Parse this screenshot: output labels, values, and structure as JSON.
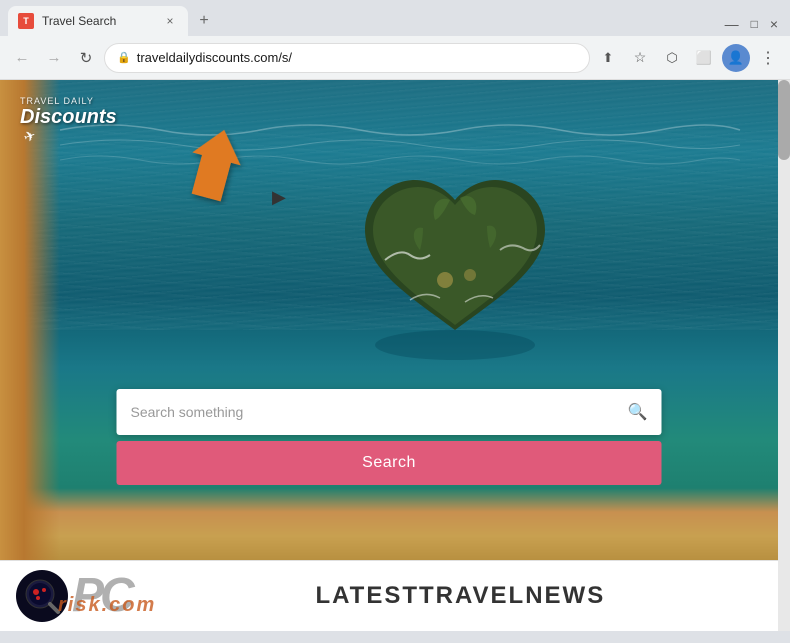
{
  "browser": {
    "tab": {
      "favicon_label": "T",
      "title": "Travel Search",
      "close_label": "×"
    },
    "new_tab_label": "+",
    "window_controls": {
      "minimize": "—",
      "maximize": "□",
      "close": "×"
    },
    "toolbar": {
      "back_label": "←",
      "forward_label": "→",
      "reload_label": "↻",
      "address": "traveldailydiscounts.com/s/",
      "share_icon": "⬆",
      "star_icon": "☆",
      "extensions_icon": "🧩",
      "split_icon": "⬜",
      "profile_icon": "👤",
      "menu_icon": "⋮"
    }
  },
  "page": {
    "logo": {
      "tagline": "Travel Daily",
      "brand": "Discounts"
    },
    "search": {
      "placeholder": "Search something",
      "button_label": "Search"
    },
    "footer": {
      "news_label_latest": "LATEST",
      "news_label_travel": " TRAVEL ",
      "news_label_news": "NEWS"
    }
  },
  "colors": {
    "search_button": "#e05a7a",
    "orange_accent": "#e07a20",
    "watermark": "rgba(200,90,30,0.75)"
  }
}
